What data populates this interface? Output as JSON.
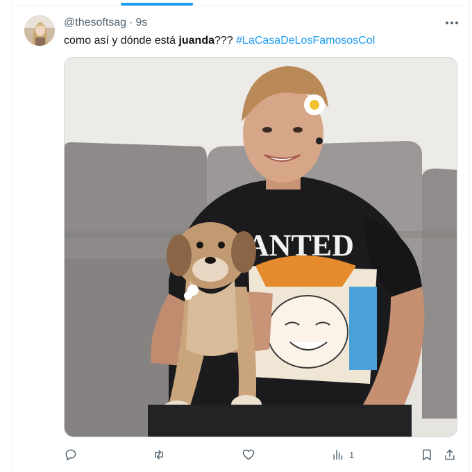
{
  "tweet": {
    "handle": "@thesoftsag",
    "separator": "·",
    "time": "9s",
    "text_prefix": "como así y dónde está ",
    "text_bold": "juanda",
    "text_suffix": "??? ",
    "hashtag": "#LaCasaDeLosFamososCol"
  },
  "media": {
    "shirt_print": "ANTED"
  },
  "actions": {
    "reply_icon": "reply-icon",
    "retweet_icon": "retweet-icon",
    "like_icon": "heart-icon",
    "views_icon": "views-icon",
    "views_count": "1",
    "bookmark_icon": "bookmark-icon",
    "share_icon": "share-icon"
  },
  "colors": {
    "accent": "#1d9bf0",
    "muted": "#536471",
    "text": "#0f1419"
  }
}
